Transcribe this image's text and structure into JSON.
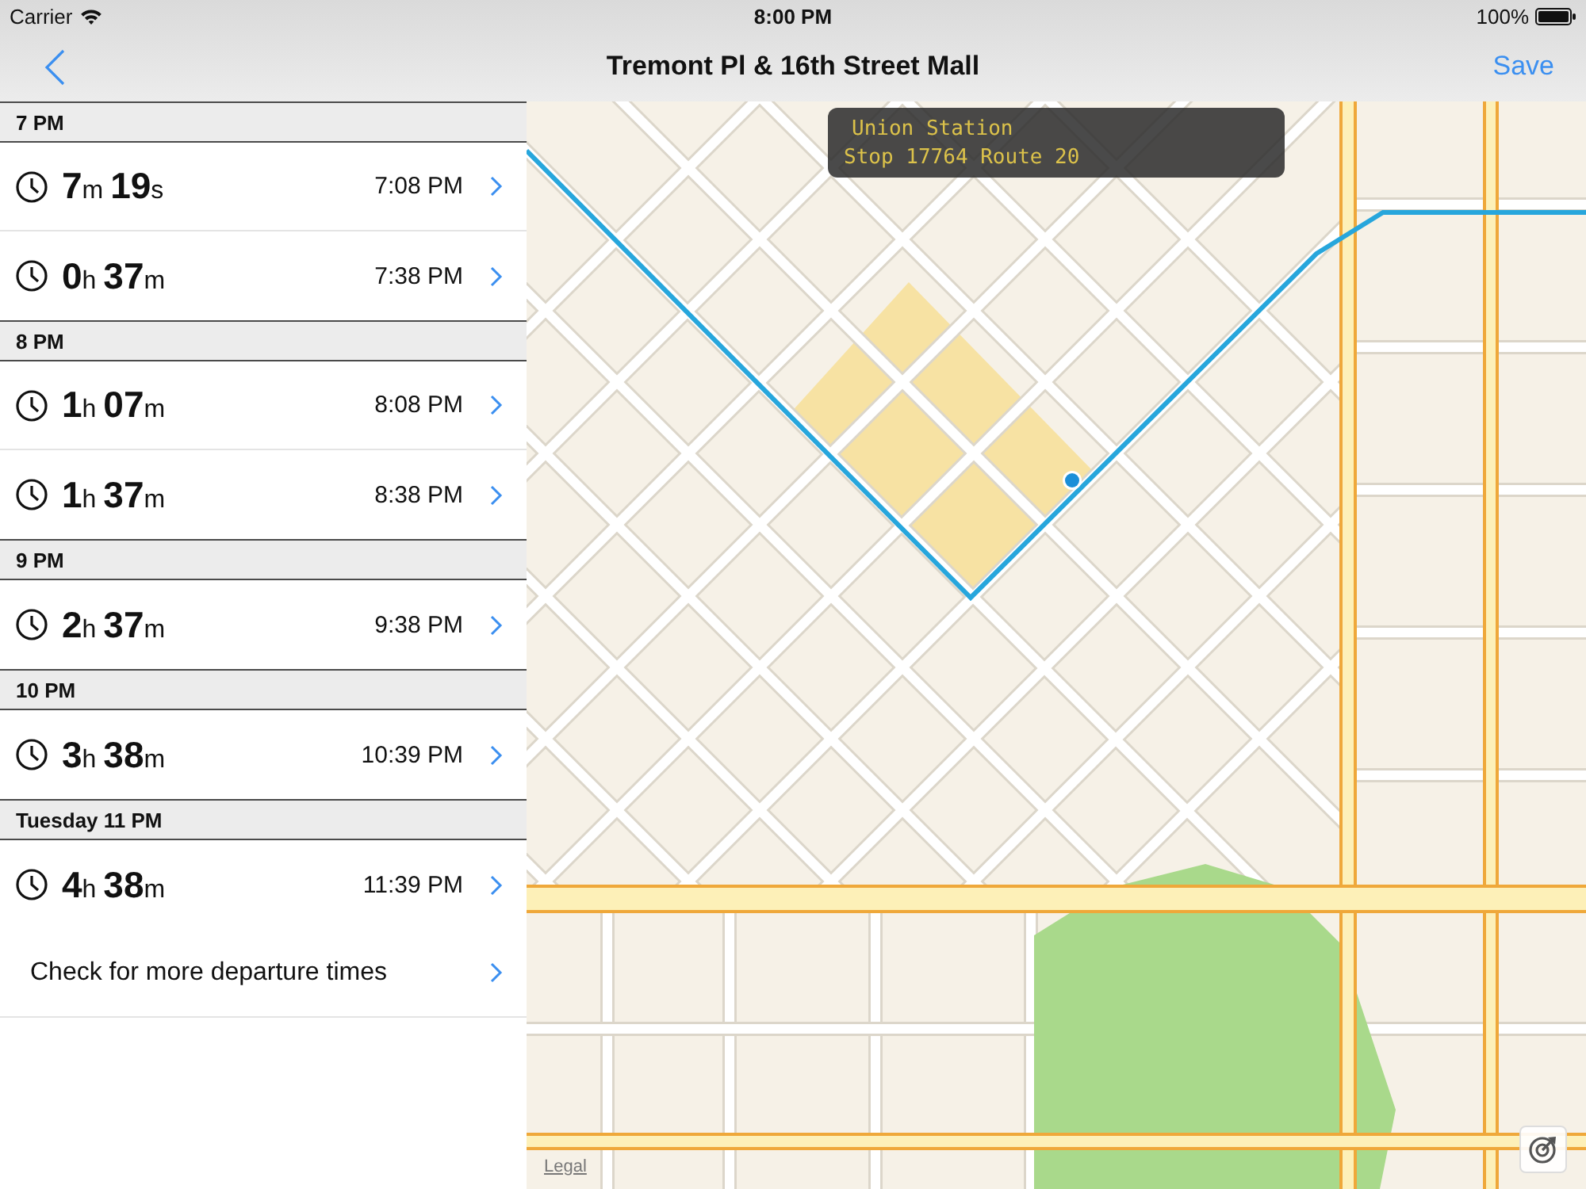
{
  "status_bar": {
    "carrier": "Carrier",
    "time": "8:00 PM",
    "battery": "100%"
  },
  "nav_bar": {
    "title": "Tremont Pl & 16th Street Mall",
    "action": "Save"
  },
  "departures": [
    {
      "header": "7 PM",
      "rows": [
        {
          "duration": [
            {
              "value": "7",
              "unit": "m"
            },
            {
              "value": "19",
              "unit": "s"
            }
          ],
          "time": "7:08 PM"
        },
        {
          "duration": [
            {
              "value": "0",
              "unit": "h"
            },
            {
              "value": "37",
              "unit": "m"
            }
          ],
          "time": "7:38 PM"
        }
      ]
    },
    {
      "header": "8 PM",
      "rows": [
        {
          "duration": [
            {
              "value": "1",
              "unit": "h"
            },
            {
              "value": "07",
              "unit": "m"
            }
          ],
          "time": "8:08 PM"
        },
        {
          "duration": [
            {
              "value": "1",
              "unit": "h"
            },
            {
              "value": "37",
              "unit": "m"
            }
          ],
          "time": "8:38 PM"
        }
      ]
    },
    {
      "header": "9 PM",
      "rows": [
        {
          "duration": [
            {
              "value": "2",
              "unit": "h"
            },
            {
              "value": "37",
              "unit": "m"
            }
          ],
          "time": "9:38 PM"
        }
      ]
    },
    {
      "header": "10 PM",
      "rows": [
        {
          "duration": [
            {
              "value": "3",
              "unit": "h"
            },
            {
              "value": "38",
              "unit": "m"
            }
          ],
          "time": "10:39 PM"
        }
      ]
    },
    {
      "header": "Tuesday 11 PM",
      "rows": [
        {
          "duration": [
            {
              "value": "4",
              "unit": "h"
            },
            {
              "value": "38",
              "unit": "m"
            }
          ],
          "time": "11:39 PM"
        }
      ]
    }
  ],
  "more_departures": {
    "label": "Check for more departure times"
  },
  "map": {
    "callout": {
      "title": "Union Station",
      "detail": "Stop 17764 Route 20"
    },
    "legal_link": "Legal"
  }
}
